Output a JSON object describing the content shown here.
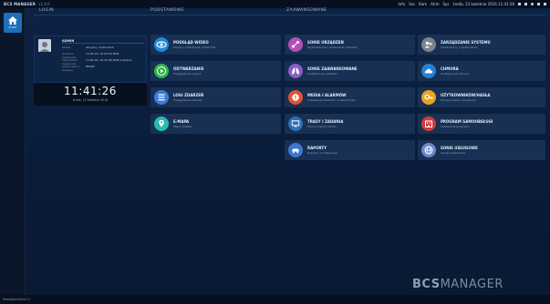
{
  "topbar": {
    "brand": "BCS MANAGER",
    "version": "v1.0.0",
    "right_items": [
      "Info",
      "Sec",
      "Kam",
      "Alrm",
      "Sys",
      "środa, 13 kwietnia 2016 11:41:26"
    ],
    "icons": [
      "bell-icon",
      "lock-icon",
      "help-icon",
      "minimize-icon",
      "close-icon"
    ]
  },
  "sidebar": {
    "home_label": "START"
  },
  "columns": {
    "login": "LOGIN",
    "basic": "PODSTAWOWE",
    "advanced": "ZAAWANSOWANE"
  },
  "login": {
    "title": "ADMIN",
    "rows": [
      {
        "k": "Status",
        "v": "Aktywny uzytkownik"
      },
      {
        "k": "Ostatnie logowanie",
        "v": "13.04.16, 10:54:44 BCM"
      },
      {
        "k": "Poprzednie logowanie",
        "v": "13.04.16, 10:34:46 BCM pulpitem"
      },
      {
        "k": "Uprawnienia dostepu",
        "v": "PELNE"
      }
    ]
  },
  "clock": {
    "time": "11:41:26",
    "date": "środa, 13 kwietnia 2016"
  },
  "basic_tiles": [
    {
      "title": "PODGLĄD WIDEO",
      "sub": "Kamery, rejestracja, obraz PTZ",
      "color": "#1e88d8",
      "icon": "eye-icon"
    },
    {
      "title": "ODTWARZANIE",
      "sub": "Przeglądanie nagrań",
      "color": "#2fb34a",
      "icon": "play-icon"
    },
    {
      "title": "LOGI ZDARZEŃ",
      "sub": "Przeglądanie zdarzeń",
      "color": "#3d7ed6",
      "icon": "list-icon"
    },
    {
      "title": "E-MAPA",
      "sub": "Mapy obiektu",
      "color": "#28b9b0",
      "icon": "map-icon"
    }
  ],
  "adv_left": [
    {
      "title": "SONIE URZĄDZEŃ",
      "sub": "Wyszukiwanie i dodawanie urządzeń",
      "color": "#b44fb8",
      "icon": "network-icon"
    },
    {
      "title": "SONIE ZAAWANSOWANE",
      "sub": "Konfiguracja urządzeń",
      "color": "#8a5cc8",
      "icon": "lungs-icon"
    },
    {
      "title": "MEDIA I ALARMÓW",
      "sub": "Ustawienia alarmów i powiadomień",
      "color": "#e05236",
      "icon": "alarm-icon"
    },
    {
      "title": "TRASY I ZADANIA",
      "sub": "Harmonogram zadań",
      "color": "#2e6fb6",
      "icon": "monitor-icon"
    },
    {
      "title": "RAPORTY",
      "sub": "Raporty i konfiguracja",
      "color": "#3e78cc",
      "icon": "car-icon"
    }
  ],
  "adv_right": [
    {
      "title": "ZARZĄDZANIE SYSTEMU",
      "sub": "Uzytkownicy i uprawnienia",
      "color": "#7c8290",
      "icon": "users-icon"
    },
    {
      "title": "CHMURA",
      "sub": "Konfiguracja chmury",
      "color": "#2a7fd0",
      "icon": "cloud-icon"
    },
    {
      "title": "UŻYTKOWNIKÓW/HASŁA",
      "sub": "Zmiana hasła i uprawnień",
      "color": "#e8a322",
      "icon": "key-icon"
    },
    {
      "title": "PROGRAM SAMOOBSŁUGI",
      "sub": "Ustawienia programu",
      "color": "#cf3d3d",
      "icon": "building-icon"
    },
    {
      "title": "SONIE USŁUGOWE",
      "sub": "Usługi systemowe",
      "color": "#6e86c9",
      "icon": "globe-icon"
    }
  ],
  "footer": {
    "logo_bold": "BCS",
    "logo_rest": "MANAGER",
    "status": "Powiadomienia 0"
  }
}
